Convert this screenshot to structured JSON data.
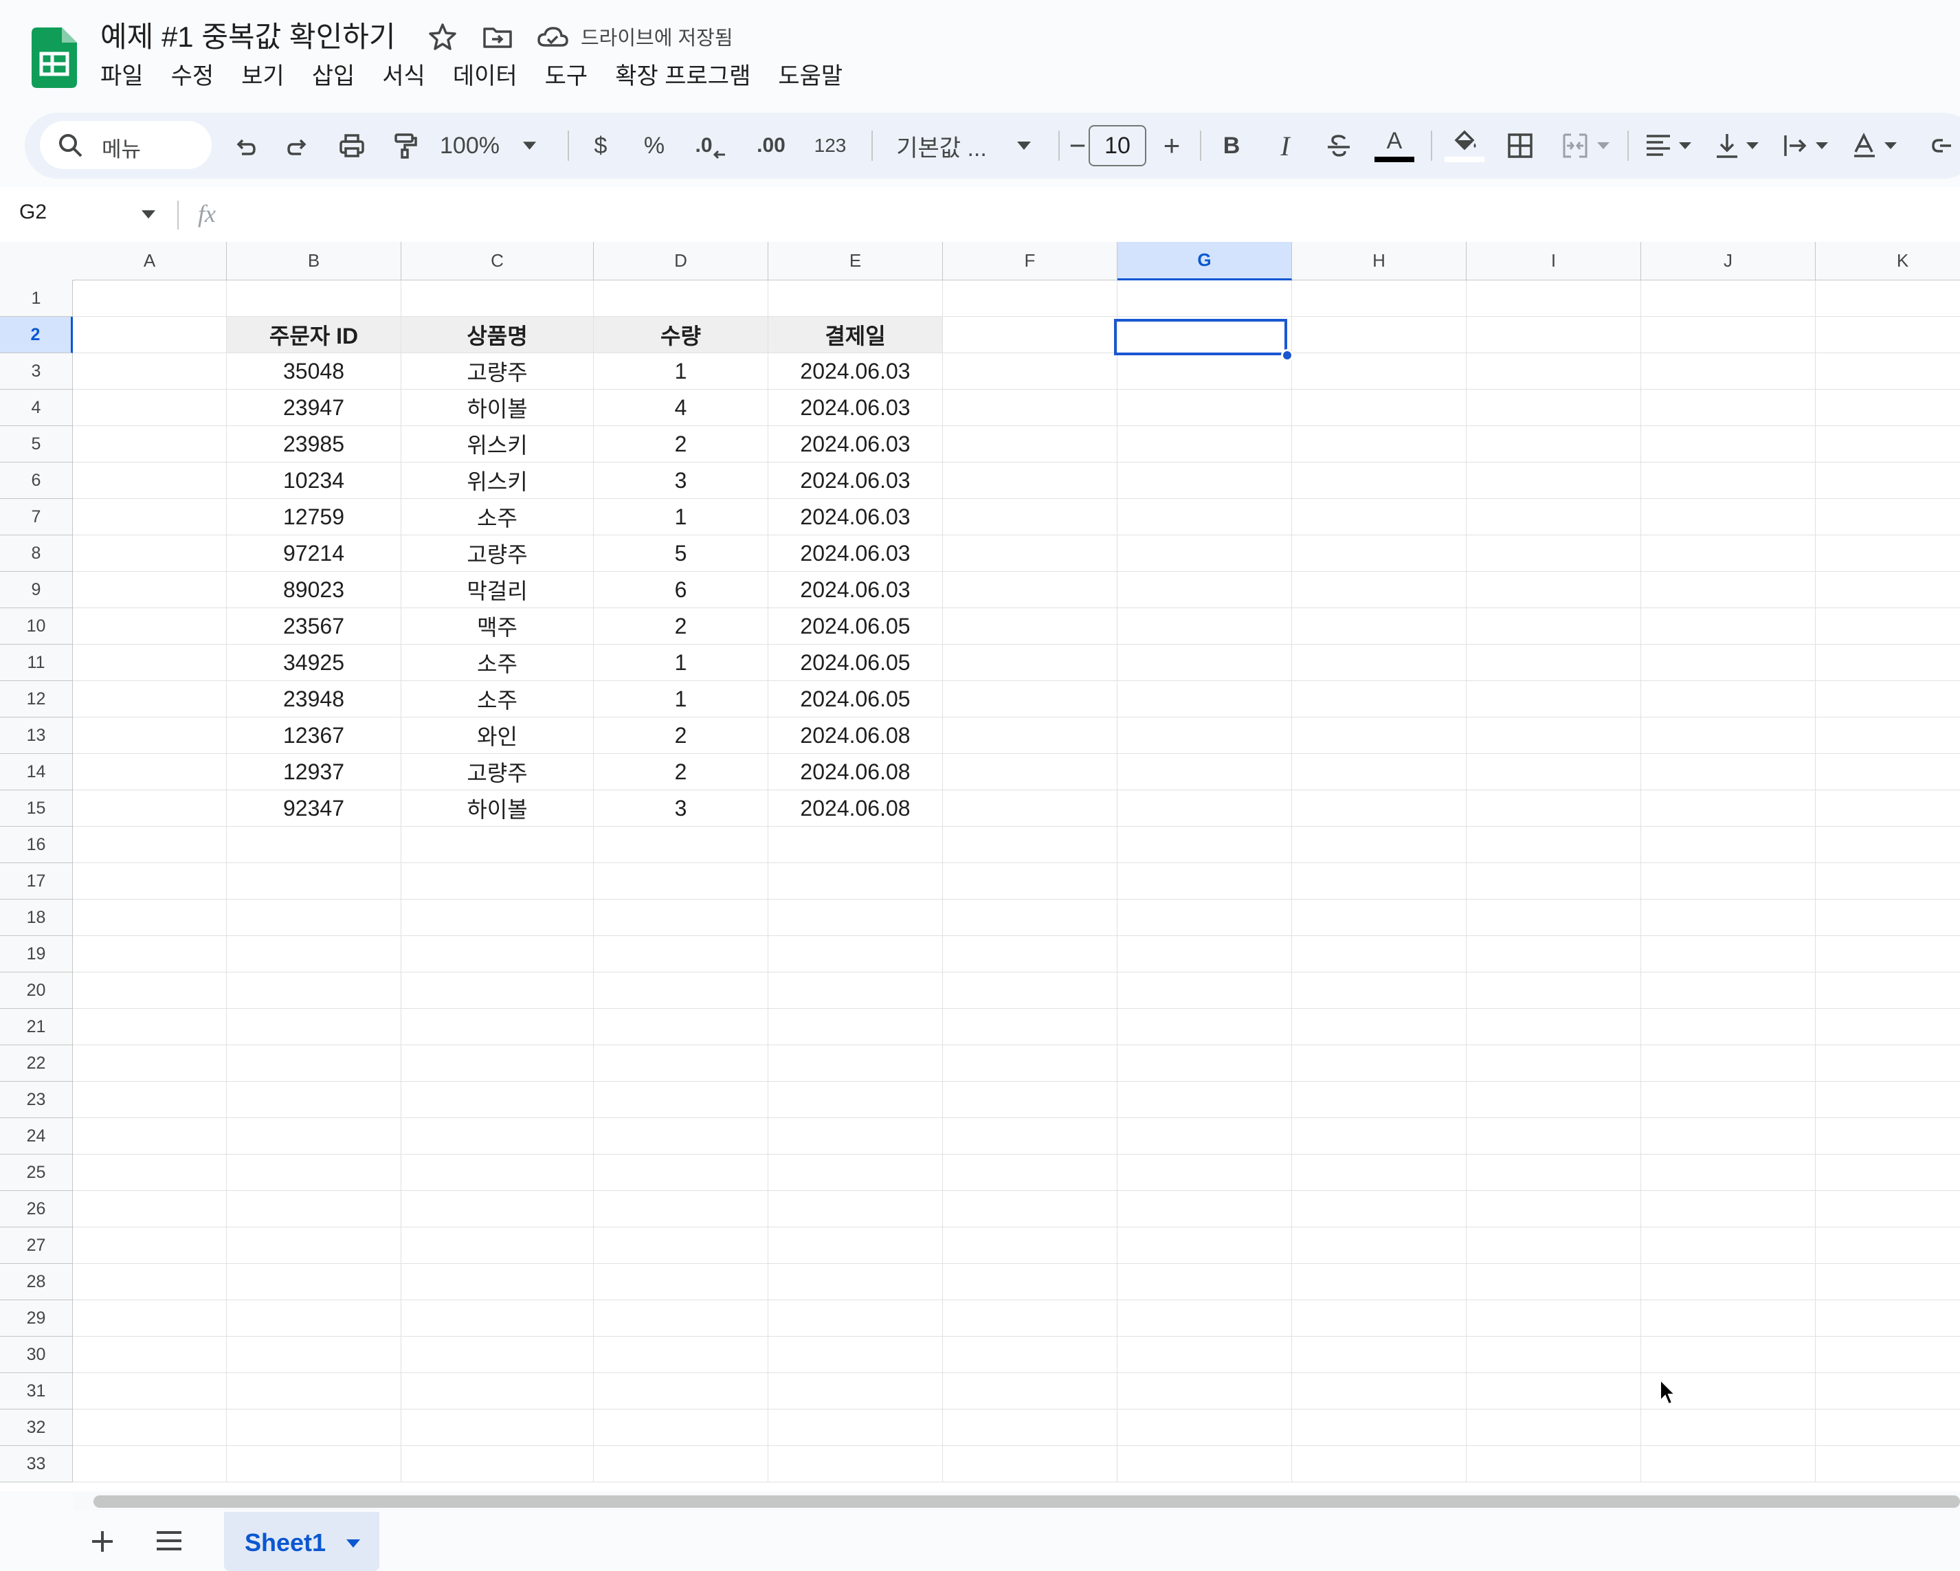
{
  "app": {
    "title": "예제 #1 중복값 확인하기",
    "save_status": "드라이브에 저장됨"
  },
  "menu": [
    "파일",
    "수정",
    "보기",
    "삽입",
    "서식",
    "데이터",
    "도구",
    "확장 프로그램",
    "도움말"
  ],
  "toolbar": {
    "search_label": "메뉴",
    "zoom": "100%",
    "currency": "$",
    "percent": "%",
    "decrease_decimal": ".0",
    "increase_decimal": ".00",
    "number_format": "123",
    "font_name": "기본값 ...",
    "font_size": "10",
    "minus": "−",
    "plus": "+",
    "bold": "B",
    "italic": "I",
    "text_color_label": "A",
    "text_color": "#000000"
  },
  "formula_bar": {
    "cell_ref": "G2",
    "fx": "fx"
  },
  "columns": [
    "A",
    "B",
    "C",
    "D",
    "E",
    "F",
    "G",
    "H",
    "I",
    "J",
    "K"
  ],
  "selected_column": "G",
  "selected_row": 2,
  "table": {
    "headers": [
      "주문자 ID",
      "상품명",
      "수량",
      "결제일"
    ],
    "rows": [
      [
        "35048",
        "고량주",
        "1",
        "2024.06.03"
      ],
      [
        "23947",
        "하이볼",
        "4",
        "2024.06.03"
      ],
      [
        "23985",
        "위스키",
        "2",
        "2024.06.03"
      ],
      [
        "10234",
        "위스키",
        "3",
        "2024.06.03"
      ],
      [
        "12759",
        "소주",
        "1",
        "2024.06.03"
      ],
      [
        "97214",
        "고량주",
        "5",
        "2024.06.03"
      ],
      [
        "89023",
        "막걸리",
        "6",
        "2024.06.03"
      ],
      [
        "23567",
        "맥주",
        "2",
        "2024.06.05"
      ],
      [
        "34925",
        "소주",
        "1",
        "2024.06.05"
      ],
      [
        "23948",
        "소주",
        "1",
        "2024.06.05"
      ],
      [
        "12367",
        "와인",
        "2",
        "2024.06.08"
      ],
      [
        "12937",
        "고량주",
        "2",
        "2024.06.08"
      ],
      [
        "92347",
        "하이볼",
        "3",
        "2024.06.08"
      ]
    ]
  },
  "row_count": 33,
  "sheets": [
    {
      "name": "Sheet1",
      "active": true
    }
  ],
  "colors": {
    "accent": "#0b57d0",
    "sheets_green": "#0f9d58",
    "toolbar_bg": "#edf2fa",
    "header_fill": "#efefef"
  }
}
